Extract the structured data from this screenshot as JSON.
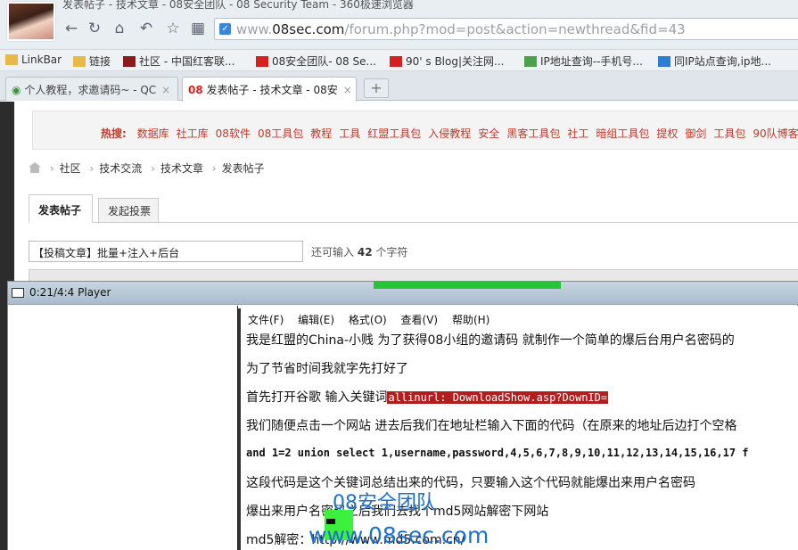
{
  "browser": {
    "window_title": "发表帖子 - 技术文章 - 08安全团队 - 08 Security Team - 360极速浏览器",
    "url_prefix": "www.",
    "url_domain": "08sec.com",
    "url_path": "/forum.php?mod=post&action=newthread&fid=43",
    "bookmarks": [
      {
        "label": "LinkBar",
        "icon": "folder-icon"
      },
      {
        "label": "链接",
        "icon": "folder-icon"
      },
      {
        "label": "社区 - 中国红客联...",
        "icon": "huc-icon"
      },
      {
        "label": "08安全团队- 08 Se...",
        "icon": "08-icon"
      },
      {
        "label": "90' s Blog|关注网...",
        "icon": "90-icon"
      },
      {
        "label": "IP地址查询--手机号...",
        "icon": "puzzle-icon"
      },
      {
        "label": "同IP站点查询,ip地...",
        "icon": "phone-icon"
      }
    ],
    "tabs": [
      {
        "label": "个人教程，求邀请码~ - QC",
        "active": false
      },
      {
        "label": "发表帖子 - 技术文章 - 08安",
        "active": true
      }
    ],
    "new_tab": "+"
  },
  "page": {
    "hot_label": "热搜:",
    "hot_keywords": [
      "数据库",
      "社工库",
      "08软件",
      "08工具包",
      "教程",
      "工具",
      "红盟工具包",
      "入侵教程",
      "安全",
      "黑客工具包",
      "社工",
      "暗组工具包",
      "提权",
      "御剑",
      "工具包",
      "90队博客"
    ],
    "breadcrumb": [
      "社区",
      "技术交流",
      "技术文章",
      "发表帖子"
    ],
    "tabs": [
      "发表帖子",
      "发起投票"
    ],
    "subject_value": "【投稿文章】批量+注入+后台",
    "remain_prefix": "还可输入",
    "remain_count": "42",
    "remain_suffix": "个字符"
  },
  "player": {
    "title": "0:21/4:4 Player",
    "menu": [
      "文件(F)",
      "编辑(E)",
      "格式(O)",
      "查看(V)",
      "帮助(H)"
    ],
    "lines": {
      "l1": "我是红盟的China-小贱 为了获得08小组的邀请码 就制作一个简单的爆后台用户名密码的",
      "l2": "为了节省时间我就字先打好了",
      "l3_prefix": "首先打开谷歌 输入关键词",
      "l3_highlight": "allinurl: DownloadShow.asp?DownID=",
      "l4": "我们随便点击一个网站 进去后我们在地址栏输入下面的代码（在原来的地址后边打个空格",
      "l5": "and 1=2 union select 1,username,password,4,5,6,7,8,9,10,11,12,13,14,15,16,17 f",
      "l6": "这段代码是这个关键词总结出来的代码，只要输入这个代码就能爆出来用户名密码",
      "l7": "爆出来用户名密码之后我们去找个md5网站解密下网站",
      "l8": "md5解密：http://www.md5.com.cn/"
    },
    "watermark_top": "08安全团队",
    "watermark_bottom": "www.08sec.com"
  },
  "colors": {
    "hot_link": "#c0392b",
    "highlight_bg": "#b01e1e",
    "watermark": "#1d6fd0",
    "green_bar": "#27c438"
  }
}
